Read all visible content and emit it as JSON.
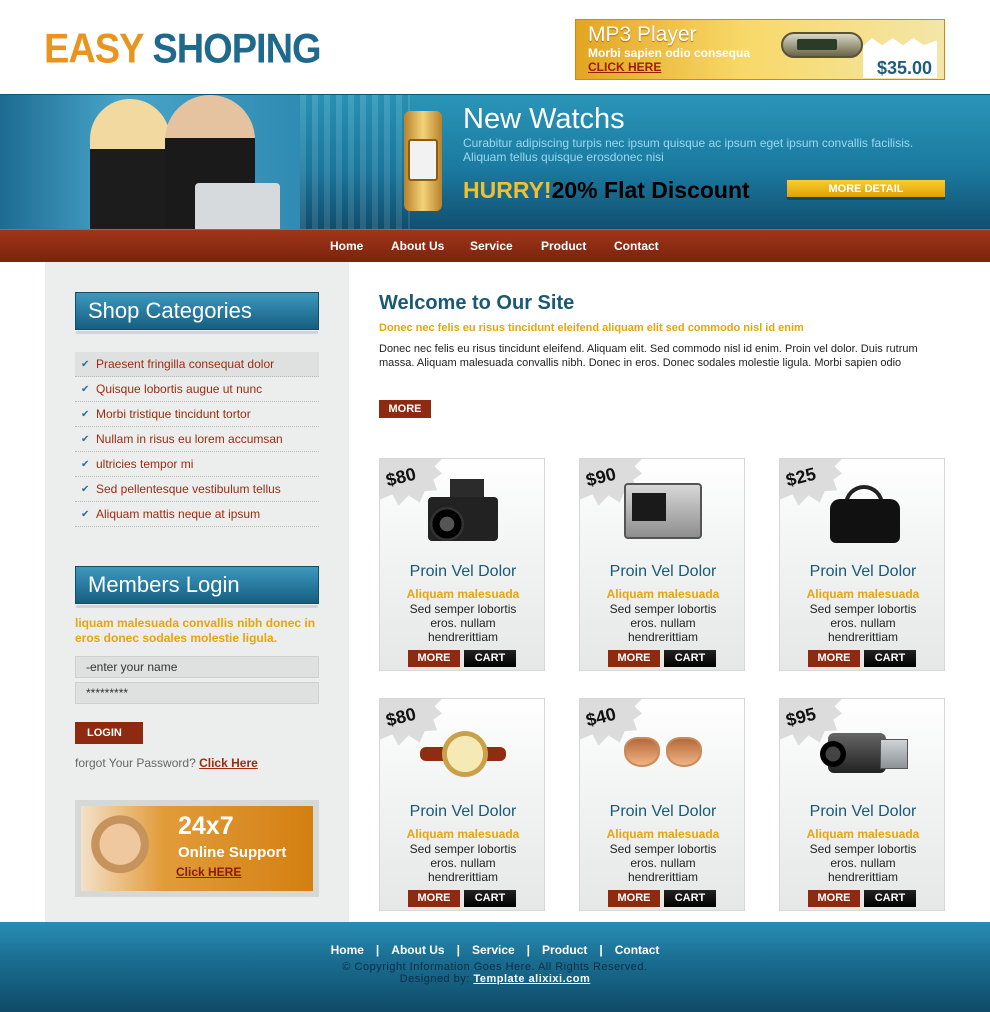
{
  "logo": {
    "part1": "EASY",
    "part2": "SHOPING"
  },
  "promo": {
    "title": "MP3 Player",
    "subtitle": "Morbi sapien odio consequa",
    "link": "CLICK HERE",
    "price": "$35.00"
  },
  "banner": {
    "title": "New Watchs",
    "desc": "Curabitur adipiscing turpis nec ipsum quisque ac ipsum eget ipsum convallis facilisis. Aliquam tellus quisque erosdonec nisi",
    "hurry": "HURRY!",
    "discount": "20% Flat Discount",
    "button": "MORE DETAIL"
  },
  "nav": [
    "Home",
    "About Us",
    "Service",
    "Product",
    "Contact"
  ],
  "sidebar": {
    "categories_title": "Shop Categories",
    "categories": [
      "Praesent fringilla consequat dolor",
      "Quisque lobortis augue ut nunc",
      "Morbi tristique tincidunt tortor",
      "Nullam in risus eu lorem accumsan",
      "ultricies tempor mi",
      "Sed pellentesque vestibulum tellus",
      "Aliquam mattis neque at ipsum"
    ],
    "login_title": "Members Login",
    "login_note": "liquam malesuada convallis nibh donec in eros donec sodales molestie ligula.",
    "username_placeholder": "-enter your name",
    "password_value": "*********",
    "login_button": "LOGIN",
    "forgot_text": "forgot Your Password?",
    "forgot_link": "Click Here",
    "support": {
      "hours": "24x7",
      "label": "Online Support",
      "link": "Click HERE"
    }
  },
  "main": {
    "welcome": "Welcome to Our Site",
    "subtitle": "Donec nec felis eu risus tincidunt eleifend aliquam elit sed commodo nisl id enim",
    "body": "Donec nec felis eu risus tincidunt eleifend. Aliquam elit. Sed commodo nisl id enim. Proin vel dolor. Duis rutrum massa. Aliquam malesuada convallis nibh. Donec in eros. Donec sodales molestie ligula. Morbi sapien odio",
    "more": "MORE"
  },
  "products": [
    {
      "price": "$80",
      "name": "Proin Vel Dolor",
      "sub": "Aliquam malesuada",
      "desc": "Sed semper lobortis eros. nullam hendrerittiam",
      "more": "MORE",
      "cart": "CART",
      "icon": "camera-icon"
    },
    {
      "price": "$90",
      "name": "Proin Vel Dolor",
      "sub": "Aliquam malesuada",
      "desc": "Sed semper lobortis eros. nullam hendrerittiam",
      "more": "MORE",
      "cart": "CART",
      "icon": "digital-camera-icon"
    },
    {
      "price": "$25",
      "name": "Proin Vel Dolor",
      "sub": "Aliquam malesuada",
      "desc": "Sed semper lobortis eros. nullam hendrerittiam",
      "more": "MORE",
      "cart": "CART",
      "icon": "handbag-icon"
    },
    {
      "price": "$80",
      "name": "Proin Vel Dolor",
      "sub": "Aliquam malesuada",
      "desc": "Sed semper lobortis eros. nullam hendrerittiam",
      "more": "MORE",
      "cart": "CART",
      "icon": "wristwatch-icon"
    },
    {
      "price": "$40",
      "name": "Proin Vel Dolor",
      "sub": "Aliquam malesuada",
      "desc": "Sed semper lobortis eros. nullam hendrerittiam",
      "more": "MORE",
      "cart": "CART",
      "icon": "sunglasses-icon"
    },
    {
      "price": "$95",
      "name": "Proin Vel Dolor",
      "sub": "Aliquam malesuada",
      "desc": "Sed semper lobortis eros. nullam hendrerittiam",
      "more": "MORE",
      "cart": "CART",
      "icon": "camcorder-icon"
    }
  ],
  "footer": {
    "links": [
      "Home",
      "About Us",
      "Service",
      "Product",
      "Contact"
    ],
    "separator": "|",
    "copyright": "© Copyright Information Goes Here. All Rights Reserved.",
    "designed_by": "Designed by:",
    "designer": "Template alixixi.com"
  }
}
